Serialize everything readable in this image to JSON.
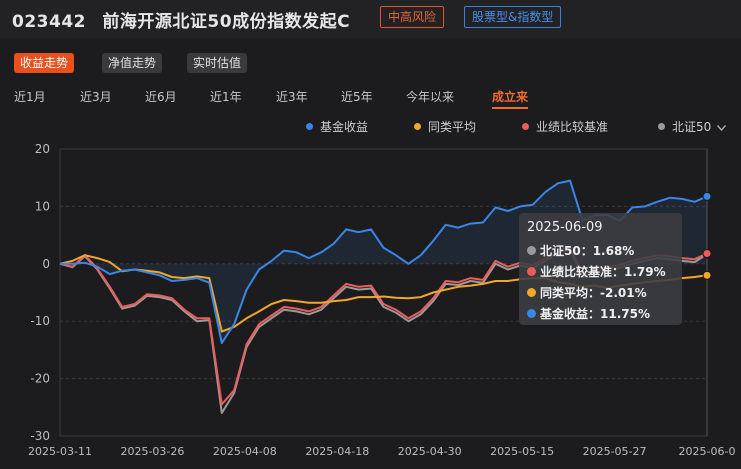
{
  "header": {
    "fund_code": "023442",
    "fund_name": "前海开源北证50成份指数发起C",
    "risk_tag": "中高风险",
    "type_tag": "股票型&指数型"
  },
  "view_tabs": [
    {
      "label": "收益走势",
      "active": true
    },
    {
      "label": "净值走势",
      "active": false
    },
    {
      "label": "实时估值",
      "active": false
    }
  ],
  "period_tabs": [
    {
      "label": "近1月",
      "active": false
    },
    {
      "label": "近3月",
      "active": false
    },
    {
      "label": "近6月",
      "active": false
    },
    {
      "label": "近1年",
      "active": false
    },
    {
      "label": "近3年",
      "active": false
    },
    {
      "label": "近5年",
      "active": false
    },
    {
      "label": "今年以来",
      "active": false
    },
    {
      "label": "成立来",
      "active": true
    }
  ],
  "legend_more_icon": "chevron-down-icon",
  "tooltip": {
    "date": "2025-06-09",
    "rows": [
      {
        "label": "北证50：1.68%",
        "color": "#9a9a9a"
      },
      {
        "label": "业绩比较基准：1.79%",
        "color": "#ee5b5b"
      },
      {
        "label": "同类平均：-2.01%",
        "color": "#f2a62a"
      },
      {
        "label": "基金收益：11.75%",
        "color": "#3a86e8"
      }
    ]
  },
  "chart_data": {
    "type": "line",
    "ylim": [
      -30,
      20
    ],
    "yticks": [
      20,
      10,
      0,
      -10,
      -20,
      -30
    ],
    "grid": true,
    "legend_position": "top-right",
    "x_labels": [
      "2025-03-11",
      "2025-03-26",
      "2025-04-08",
      "2025-04-18",
      "2025-04-30",
      "2025-05-15",
      "2025-05-27",
      "2025-06-0"
    ],
    "series": [
      {
        "name": "基金收益",
        "color": "#3a86e8",
        "values": [
          0,
          0,
          0.2,
          -0.5,
          -1.8,
          -1.2,
          -1.0,
          -1.5,
          -2.0,
          -3.0,
          -2.8,
          -2.5,
          -3.3,
          -13.8,
          -10.5,
          -4.5,
          -1.0,
          0.5,
          2.3,
          2.0,
          1.0,
          2.0,
          3.5,
          6.0,
          5.5,
          6.0,
          2.8,
          1.5,
          0.0,
          1.5,
          4.0,
          6.8,
          6.3,
          7.0,
          7.2,
          9.8,
          9.2,
          10.0,
          10.3,
          12.5,
          14.0,
          14.5,
          7.5,
          8.5,
          8.5,
          7.5,
          9.8,
          10.0,
          10.8,
          11.5,
          11.3,
          10.8,
          11.75
        ]
      },
      {
        "name": "同类平均",
        "color": "#f2a62a",
        "values": [
          0,
          0.5,
          1.5,
          1.0,
          0.3,
          -1.3,
          -1.0,
          -1.2,
          -1.5,
          -2.3,
          -2.5,
          -2.2,
          -2.5,
          -11.8,
          -11.0,
          -9.5,
          -8.3,
          -7.0,
          -6.3,
          -6.5,
          -6.8,
          -6.8,
          -6.5,
          -6.3,
          -5.8,
          -5.8,
          -5.7,
          -5.9,
          -6.0,
          -5.8,
          -5.0,
          -4.5,
          -4.0,
          -3.8,
          -3.5,
          -3.0,
          -3.0,
          -2.7,
          -2.5,
          -2.5,
          -3.2,
          -3.5,
          -4.0,
          -3.8,
          -4.2,
          -3.8,
          -3.5,
          -3.2,
          -3.0,
          -2.8,
          -2.5,
          -2.3,
          -2.01
        ]
      },
      {
        "name": "业绩比较基准",
        "color": "#ee5b5b",
        "values": [
          0,
          -0.5,
          1.5,
          -0.8,
          -4.0,
          -7.5,
          -7.0,
          -5.3,
          -5.5,
          -6.0,
          -8.0,
          -9.5,
          -9.5,
          -24.5,
          -22.0,
          -14.0,
          -10.5,
          -9.0,
          -7.5,
          -7.8,
          -8.3,
          -7.5,
          -5.5,
          -3.5,
          -4.0,
          -3.8,
          -7.0,
          -8.0,
          -9.5,
          -8.3,
          -6.0,
          -3.0,
          -3.2,
          -2.5,
          -2.8,
          0.5,
          -0.5,
          0.2,
          -0.3,
          1.0,
          2.5,
          3.0,
          -2.0,
          -1.0,
          -0.5,
          -0.2,
          0.5,
          1.0,
          1.5,
          1.3,
          1.0,
          0.8,
          1.79
        ]
      },
      {
        "name": "北证50",
        "color": "#9a9a9a",
        "values": [
          0,
          -0.6,
          1.3,
          -1.0,
          -4.3,
          -7.8,
          -7.3,
          -5.6,
          -5.8,
          -6.3,
          -8.3,
          -10.0,
          -9.8,
          -26.0,
          -22.5,
          -14.5,
          -11.0,
          -9.5,
          -8.0,
          -8.3,
          -8.8,
          -8.0,
          -6.0,
          -4.0,
          -4.5,
          -4.3,
          -7.5,
          -8.5,
          -10.0,
          -8.8,
          -6.5,
          -3.5,
          -3.7,
          -3.0,
          -3.3,
          0.0,
          -1.0,
          -0.3,
          -0.8,
          0.5,
          2.0,
          2.5,
          -2.5,
          -1.5,
          -1.0,
          -0.7,
          0.0,
          0.5,
          1.0,
          0.8,
          0.5,
          0.3,
          1.68
        ]
      }
    ]
  }
}
